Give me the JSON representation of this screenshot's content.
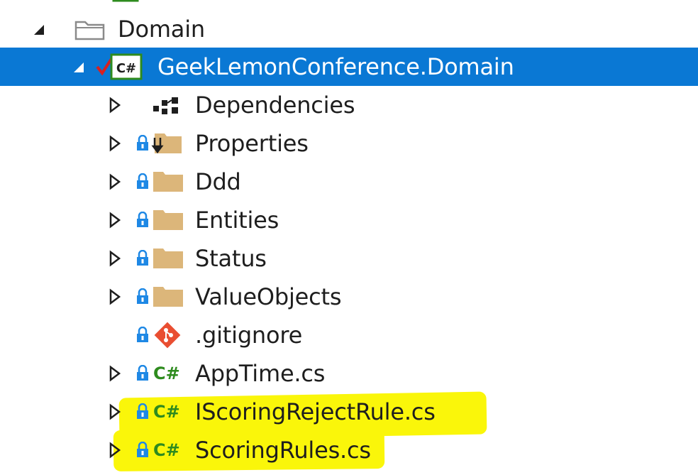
{
  "tree": {
    "top_partial": {
      "label": ""
    },
    "domain_folder": {
      "label": "Domain"
    },
    "project": {
      "label": "GeekLemonConference.Domain",
      "badge": "C#"
    },
    "items": [
      {
        "label": "Dependencies",
        "type": "dependencies",
        "expandable": true
      },
      {
        "label": "Properties",
        "type": "properties-folder",
        "expandable": true
      },
      {
        "label": "Ddd",
        "type": "folder",
        "expandable": true
      },
      {
        "label": "Entities",
        "type": "folder",
        "expandable": true
      },
      {
        "label": "Status",
        "type": "folder",
        "expandable": true
      },
      {
        "label": "ValueObjects",
        "type": "folder",
        "expandable": true
      },
      {
        "label": ".gitignore",
        "type": "git",
        "expandable": false
      },
      {
        "label": "AppTime.cs",
        "type": "cs",
        "expandable": true
      },
      {
        "label": "IScoringRejectRule.cs",
        "type": "cs",
        "expandable": true,
        "highlighted": true
      },
      {
        "label": "ScoringRules.cs",
        "type": "cs",
        "expandable": true,
        "highlighted": true
      }
    ],
    "cs_badge": "C#"
  },
  "colors": {
    "selection": "#0a78d4",
    "folder": "#dcb67a",
    "lock": "#1e88e5",
    "cs_green": "#2e8b1e",
    "git": "#e94e31",
    "highlighter": "#faf60a"
  }
}
